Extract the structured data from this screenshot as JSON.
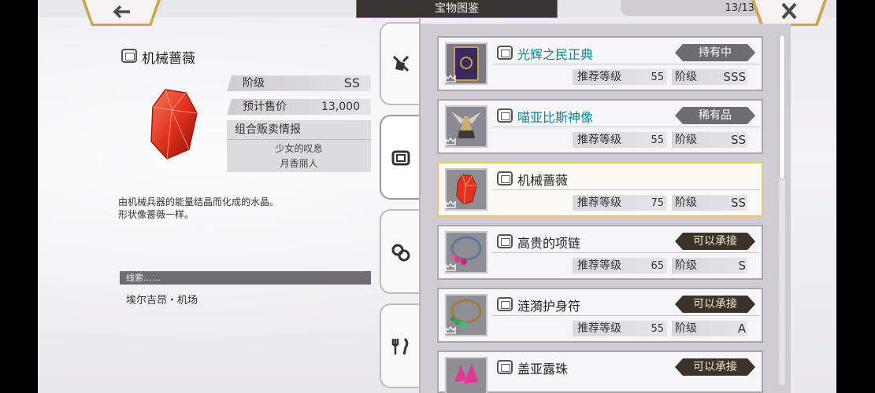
{
  "header": {
    "title": "宝物图鉴",
    "count": "13/13",
    "back_icon": "back-arrow-icon",
    "close_icon": "close-icon"
  },
  "detail": {
    "name": "机械蔷薇",
    "grade_label": "阶级",
    "grade_value": "SS",
    "price_label": "预计售价",
    "price_value": "13,000",
    "combo_title": "组合贩卖情报",
    "combo_items": [
      "少女的叹息",
      "月香丽人"
    ],
    "description_lines": [
      "由机械兵器的能量结晶而化成的水晶。",
      "形状像蔷薇一样。"
    ],
    "clue_label": "线索……",
    "clue_text": "埃尔吉昂・机场"
  },
  "tabs": [
    {
      "icon": "shield-sword-icon",
      "active": false
    },
    {
      "icon": "treasure-card-icon",
      "active": true
    },
    {
      "icon": "gear-cluster-icon",
      "active": false
    },
    {
      "icon": "fork-knife-icon",
      "active": false
    }
  ],
  "list_labels": {
    "recommend": "推荐等级",
    "grade": "阶级"
  },
  "items": [
    {
      "name": "光辉之民正典",
      "badge": "持有中",
      "badge_style": "gray",
      "name_color": "blue",
      "recommend": "55",
      "grade": "SSS",
      "thumb": "book-icon",
      "selected": false
    },
    {
      "name": "喵亚比斯神像",
      "badge": "稀有品",
      "badge_style": "gray",
      "name_color": "blue",
      "recommend": "55",
      "grade": "SS",
      "thumb": "statue-icon",
      "selected": false
    },
    {
      "name": "机械蔷薇",
      "badge": "",
      "badge_style": "",
      "name_color": "dark",
      "recommend": "75",
      "grade": "SS",
      "thumb": "red-gem-icon",
      "selected": true
    },
    {
      "name": "高贵的项链",
      "badge": "可以承接",
      "badge_style": "dark",
      "name_color": "dark",
      "recommend": "65",
      "grade": "S",
      "thumb": "necklace-pink-icon",
      "selected": false
    },
    {
      "name": "涟漪护身符",
      "badge": "可以承接",
      "badge_style": "dark",
      "name_color": "dark",
      "recommend": "55",
      "grade": "A",
      "thumb": "necklace-green-icon",
      "selected": false
    },
    {
      "name": "盖亚露珠",
      "badge": "可以承接",
      "badge_style": "dark",
      "name_color": "dark",
      "recommend": "",
      "grade": "",
      "thumb": "pink-crystal-icon",
      "selected": false
    }
  ]
}
